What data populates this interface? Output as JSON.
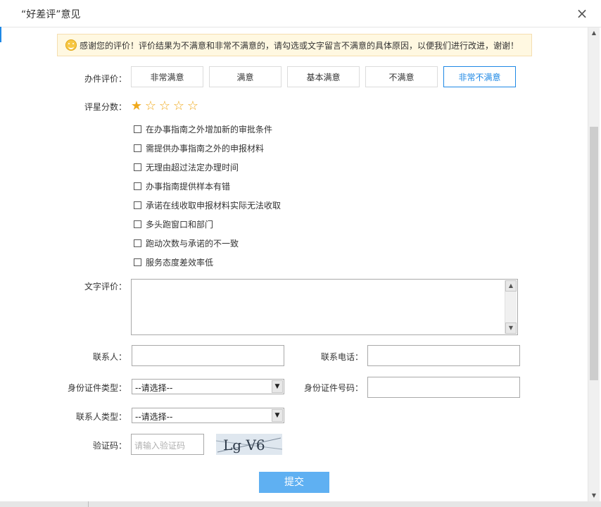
{
  "dialog": {
    "title": "“好差评”意见",
    "close_symbol": "×"
  },
  "notice": {
    "text": "感谢您的评价！评价结果为不满意和非常不满意的，请勾选或文字留言不满意的具体原因，以便我们进行改进，谢谢！"
  },
  "rating": {
    "label": "办件评价：",
    "options": [
      "非常满意",
      "满意",
      "基本满意",
      "不满意",
      "非常不满意"
    ],
    "selected": "非常不满意"
  },
  "score": {
    "label": "评星分数：",
    "filled_stars": 1,
    "total_stars": 5
  },
  "reasons": [
    "在办事指南之外增加新的审批条件",
    "需提供办事指南之外的申报材料",
    "无理由超过法定办理时间",
    "办事指南提供样本有错",
    "承诺在线收取申报材料实际无法收取",
    "多头跑窗口和部门",
    "跑动次数与承诺的不一致",
    "服务态度差效率低"
  ],
  "comment": {
    "label": "文字评价："
  },
  "contact": {
    "name_label": "联系人：",
    "phone_label": "联系电话：",
    "id_type_label": "身份证件类型：",
    "id_type_value": "--请选择--",
    "id_number_label": "身份证件号码：",
    "person_type_label": "联系人类型：",
    "person_type_value": "--请选择--",
    "captcha_label": "验证码：",
    "captcha_placeholder": "请输入验证码",
    "captcha_text": "Lg V6"
  },
  "submit": {
    "label": "提交"
  },
  "colors": {
    "accent": "#1e88e5",
    "submit_bg": "#5fb0f2",
    "star": "#f0a91b",
    "notice_bg": "#fff8e1"
  }
}
